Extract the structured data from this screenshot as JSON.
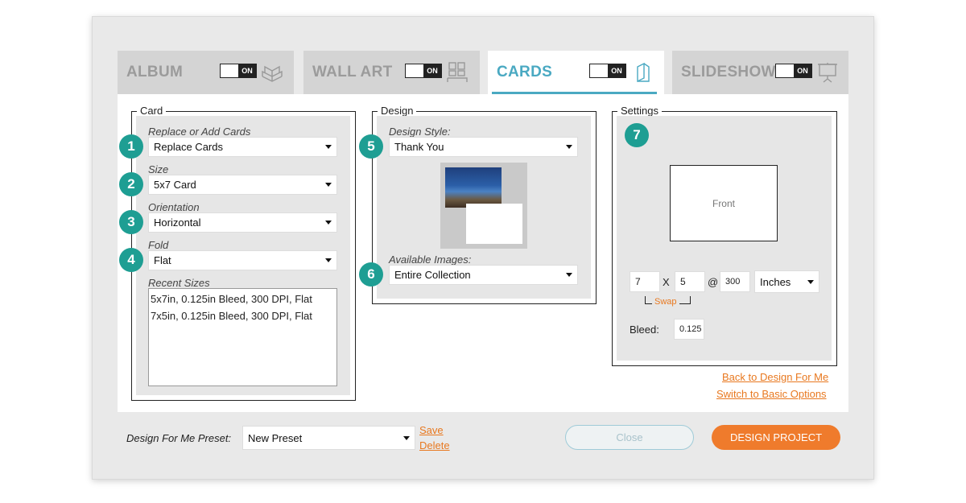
{
  "tabs": [
    {
      "label": "ALBUM",
      "toggle": "ON",
      "icon": "book-icon"
    },
    {
      "label": "WALL ART",
      "toggle": "ON",
      "icon": "frame-icon"
    },
    {
      "label": "CARDS",
      "toggle": "ON",
      "icon": "cards-icon"
    },
    {
      "label": "SLIDESHOW",
      "toggle": "ON",
      "icon": "projector-icon"
    }
  ],
  "card": {
    "legend": "Card",
    "replace_label": "Replace or Add Cards",
    "replace_value": "Replace Cards",
    "size_label": "Size",
    "size_value": "5x7 Card",
    "orientation_label": "Orientation",
    "orientation_value": "Horizontal",
    "fold_label": "Fold",
    "fold_value": "Flat",
    "recent_label": "Recent Sizes",
    "recent_items": [
      "5x7in, 0.125in Bleed, 300 DPI, Flat",
      "7x5in, 0.125in Bleed, 300 DPI, Flat"
    ]
  },
  "design": {
    "legend": "Design",
    "style_label": "Design Style:",
    "style_value": "Thank You",
    "images_label": "Available Images:",
    "images_value": "Entire Collection"
  },
  "settings": {
    "legend": "Settings",
    "front_label": "Front",
    "width": "7",
    "x_label": "X",
    "height": "5",
    "at_label": "@",
    "dpi": "300",
    "unit": "Inches",
    "swap_label": "Swap",
    "bleed_label": "Bleed:",
    "bleed_value": "0.125"
  },
  "badges": [
    "1",
    "2",
    "3",
    "4",
    "5",
    "6",
    "7"
  ],
  "links": {
    "back": "Back to Design For Me",
    "switch": "Switch to Basic Options"
  },
  "footer": {
    "preset_label": "Design For Me Preset:",
    "preset_value": "New Preset",
    "save": "Save",
    "delete": "Delete",
    "close": "Close",
    "design": "DESIGN PROJECT"
  },
  "colors": {
    "accent": "#4aa9c2",
    "badge": "#1e9e93",
    "link": "#e8781f",
    "primary_button": "#ef7b2c"
  }
}
